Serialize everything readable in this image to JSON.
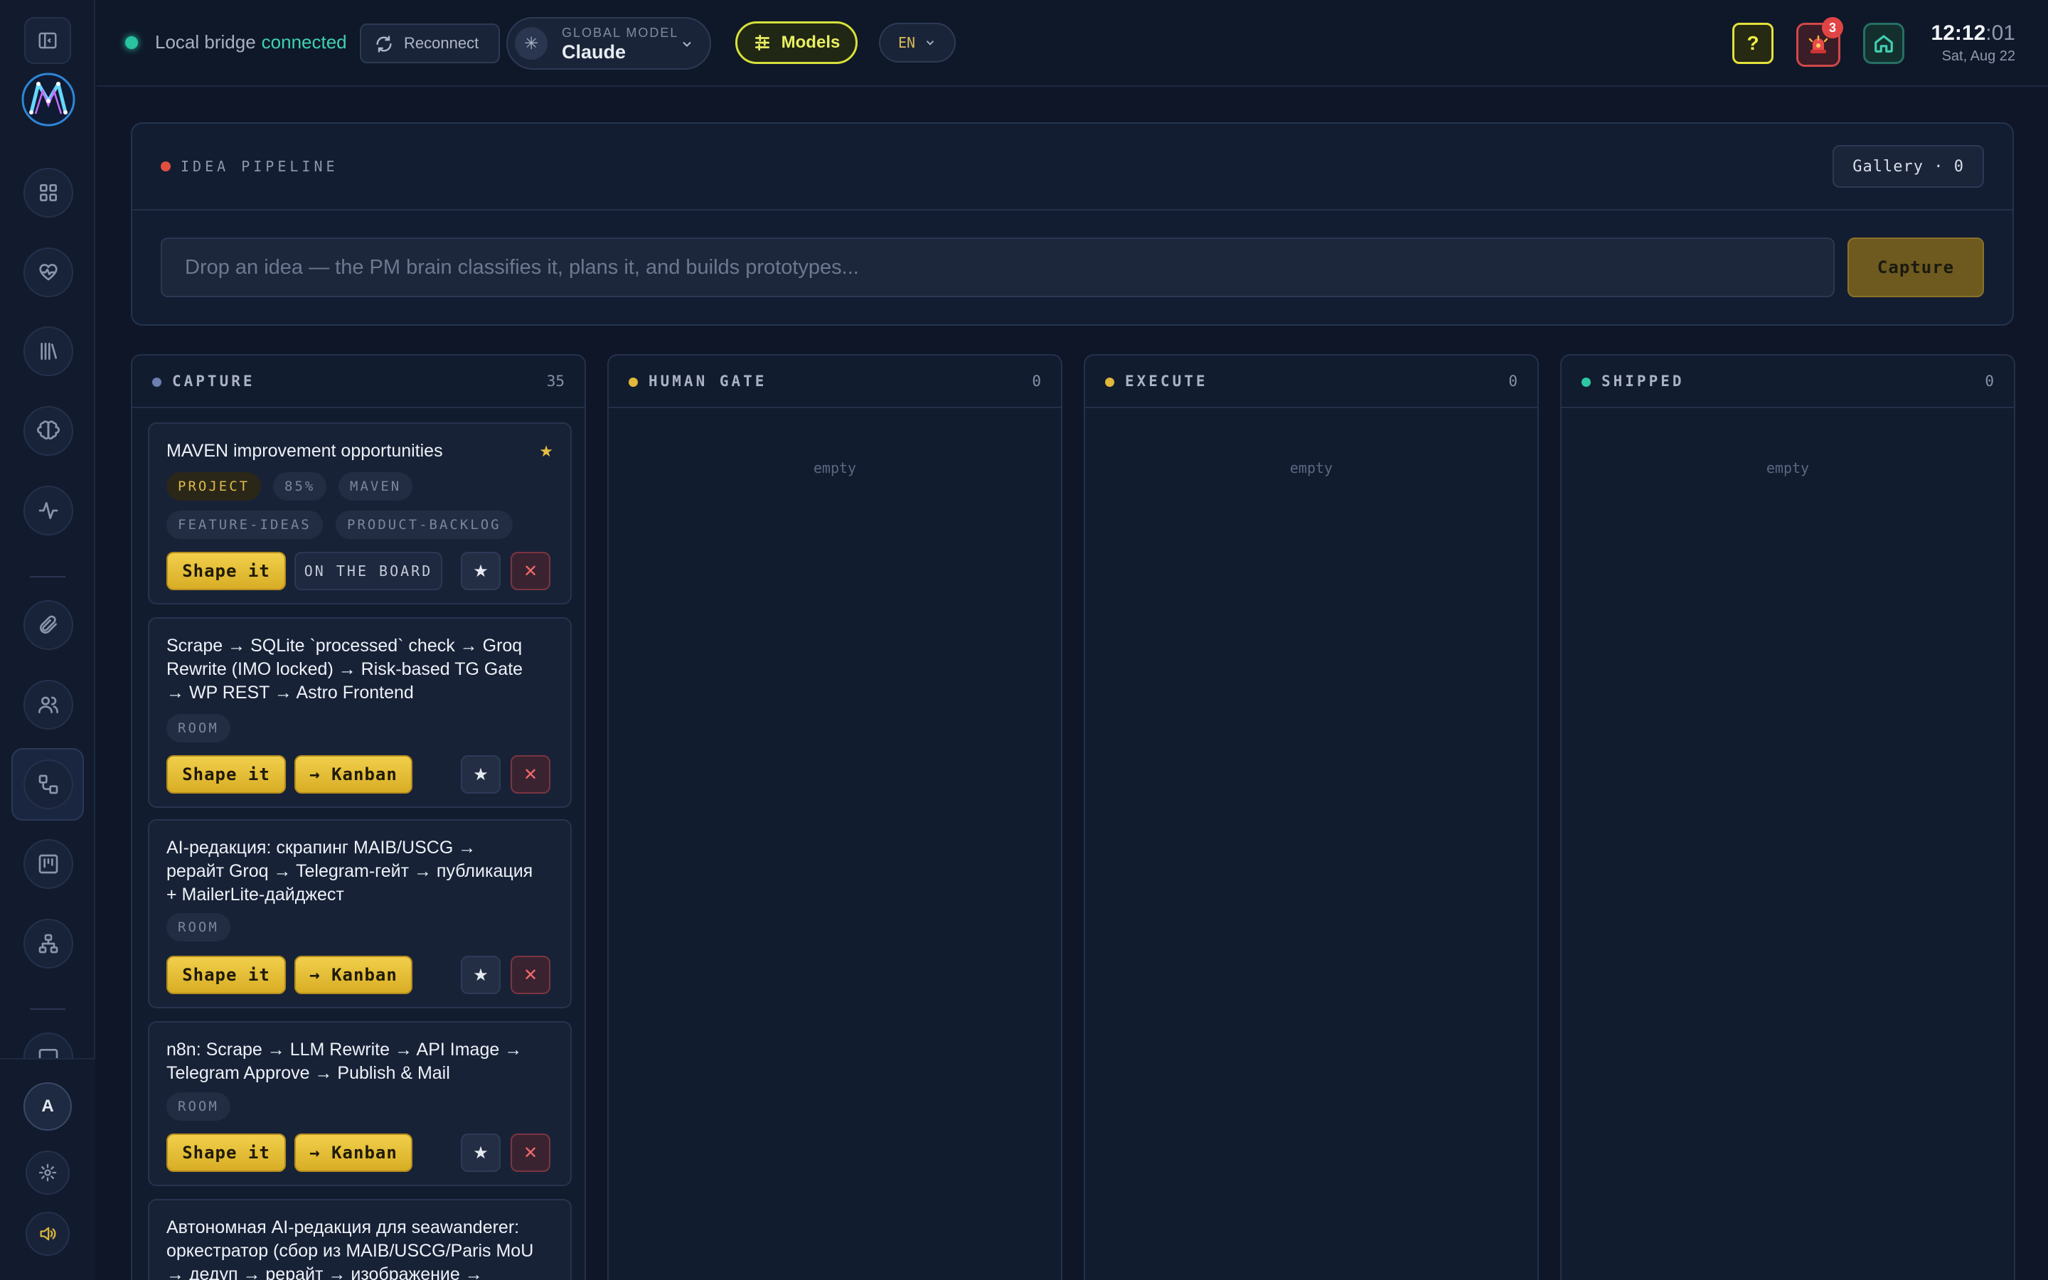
{
  "sidebar": {
    "nav_icons": [
      "layout-grid-icon",
      "heart-pulse-icon",
      "library-icon",
      "brain-icon",
      "activity-icon",
      "paperclip-icon",
      "users-icon",
      "workflow-icon",
      "kanban-icon",
      "sitemap-icon",
      "monitor-icon"
    ],
    "active_item": "workflow-icon",
    "avatar_initial": "A"
  },
  "topbar": {
    "bridge_label": "Local bridge",
    "bridge_status": "connected",
    "reconnect_label": "Reconnect",
    "global_model_label": "GLOBAL MODEL",
    "global_model_value": "Claude",
    "models_label": "Models",
    "language": "EN",
    "help_label": "?",
    "alert_count": "3",
    "clock_hm": "12:12",
    "clock_sec": ":01",
    "date": "Sat, Aug 22"
  },
  "pipeline": {
    "title": "IDEA PIPELINE",
    "gallery_label": "Gallery · 0",
    "input_placeholder": "Drop an idea — the PM brain classifies it, plans it, and builds prototypes...",
    "input_value": "",
    "capture_label": "Capture"
  },
  "columns": [
    {
      "title": "CAPTURE",
      "count": "35",
      "dot_color": "#6c7fb0"
    },
    {
      "title": "HUMAN GATE",
      "count": "0",
      "dot_color": "#e0b83a",
      "empty_label": "empty"
    },
    {
      "title": "EXECUTE",
      "count": "0",
      "dot_color": "#e0b83a",
      "empty_label": "empty"
    },
    {
      "title": "SHIPPED",
      "count": "0",
      "dot_color": "#2fc6a2",
      "empty_label": "empty"
    }
  ],
  "cards": [
    {
      "title": "MAVEN improvement opportunities",
      "star": "★",
      "tags": [
        "PROJECT",
        "85%",
        "MAVEN",
        "FEATURE-IDEAS",
        "PRODUCT-BACKLOG"
      ],
      "shape_label": "Shape it",
      "status_label": "ON THE BOARD",
      "star_btn": "★",
      "close_btn": "✕"
    },
    {
      "title": "Scrape → SQLite `processed` check → Groq Rewrite (IMO locked) → Risk-based TG Gate → WP REST → Astro Frontend",
      "tags": [
        "ROOM"
      ],
      "shape_label": "Shape it",
      "kanban_label": "→ Kanban",
      "star_btn": "★",
      "close_btn": "✕"
    },
    {
      "title": "AI-редакция: скрапинг MAIB/USCG → рерайт Groq → Telegram-гейт → публикация + MailerLite-дайджест",
      "tags": [
        "ROOM"
      ],
      "shape_label": "Shape it",
      "kanban_label": "→ Kanban",
      "star_btn": "★",
      "close_btn": "✕"
    },
    {
      "title": "n8n: Scrape → LLM Rewrite → API Image → Telegram Approve → Publish & Mail",
      "tags": [
        "ROOM"
      ],
      "shape_label": "Shape it",
      "kanban_label": "→ Kanban",
      "star_btn": "★",
      "close_btn": "✕"
    },
    {
      "title": "Автономная AI-редакция для seawanderer: оркестратор (сбор из MAIB/USCG/Paris MoU → дедуп → рерайт → изображение →"
    }
  ],
  "colors": {
    "background": "#0e1628",
    "accent_yellow": "#e0b83a",
    "accent_teal": "#2fc6a2",
    "danger": "#e14444"
  }
}
